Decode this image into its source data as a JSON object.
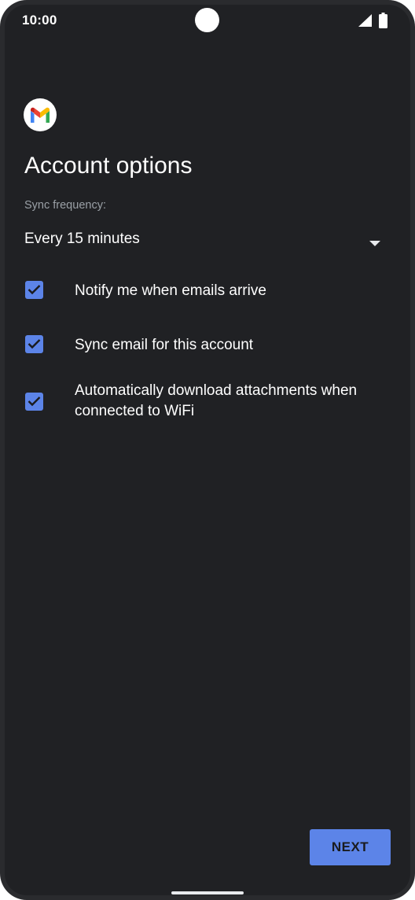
{
  "status_bar": {
    "time": "10:00",
    "signal_icon": "cellular-signal-icon",
    "battery_icon": "battery-full-icon"
  },
  "app": {
    "logo_icon": "gmail-logo-icon"
  },
  "page": {
    "title": "Account options"
  },
  "sync": {
    "label": "Sync frequency:",
    "selected_value": "Every 15 minutes",
    "dropdown_icon": "dropdown-arrow-icon"
  },
  "options": [
    {
      "label": "Notify me when emails arrive",
      "checked": true
    },
    {
      "label": "Sync email for this account",
      "checked": true
    },
    {
      "label": "Automatically download attachments when connected to WiFi",
      "checked": true
    }
  ],
  "actions": {
    "next_label": "NEXT"
  },
  "colors": {
    "background": "#202124",
    "accent": "#5c84e8",
    "text_primary": "#ffffff",
    "text_secondary": "#9aa0a6"
  }
}
